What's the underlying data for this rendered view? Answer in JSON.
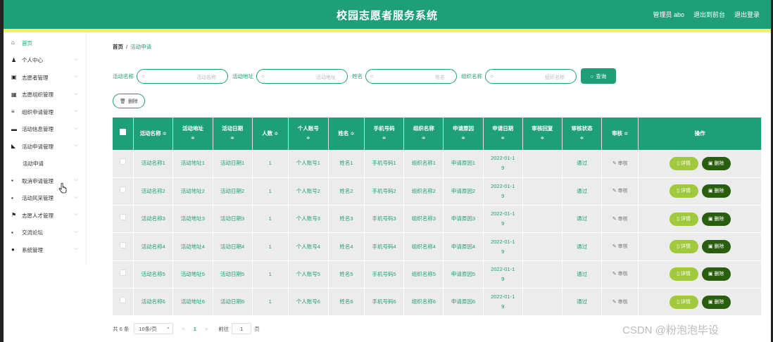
{
  "header": {
    "title": "校园志愿者服务系统",
    "links": [
      "管理员 abo",
      "退出到前台",
      "退出登录"
    ]
  },
  "sidebar": {
    "items": [
      {
        "label": "首页",
        "icon": "home-icon",
        "glyph": "⌂",
        "expandable": false
      },
      {
        "label": "个人中心",
        "icon": "user-icon",
        "glyph": "♟",
        "expandable": true
      },
      {
        "label": "志愿者管理",
        "icon": "badge-icon",
        "glyph": "▣",
        "expandable": true
      },
      {
        "label": "志愿组织管理",
        "icon": "grid-icon",
        "glyph": "▦",
        "expandable": true
      },
      {
        "label": "组织申请管理",
        "icon": "list-icon",
        "glyph": "≡",
        "expandable": true
      },
      {
        "label": "活动信息管理",
        "icon": "ticket-icon",
        "glyph": "▬",
        "expandable": true
      },
      {
        "label": "活动申请管理",
        "icon": "flag-icon",
        "glyph": "◣",
        "expandable": true,
        "sub": "活动申请"
      },
      {
        "label": "取消申请管理",
        "icon": "apps-icon",
        "glyph": "▪",
        "expandable": true
      },
      {
        "label": "活动风采管理",
        "icon": "apps-icon",
        "glyph": "▪",
        "expandable": true
      },
      {
        "label": "志愿人才管理",
        "icon": "flag-icon",
        "glyph": "⚑",
        "expandable": true
      },
      {
        "label": "交流论坛",
        "icon": "apps-icon",
        "glyph": "▪",
        "expandable": true
      },
      {
        "label": "系统管理",
        "icon": "location-icon",
        "glyph": "●",
        "expandable": true
      }
    ]
  },
  "breadcrumb": {
    "home": "首页",
    "sep": "/",
    "current": "活动申请"
  },
  "search": {
    "fields": [
      {
        "label": "活动名称",
        "placeholder": "活动名称"
      },
      {
        "label": "活动地址",
        "placeholder": "活动地址"
      },
      {
        "label": "姓名",
        "placeholder": "姓名"
      },
      {
        "label": "组织名称",
        "placeholder": "组织名称"
      }
    ],
    "query_label": "查询",
    "delete_label": "删除"
  },
  "table": {
    "columns": [
      "活动名称",
      "活动地址",
      "活动日期",
      "人数",
      "个人账号",
      "姓名",
      "手机号码",
      "组织名称",
      "申请原因",
      "申请日期",
      "审核回复",
      "审核状态",
      "审核",
      "操作"
    ],
    "rows": [
      [
        "活动名称1",
        "活动地址1",
        "活动日期1",
        "1",
        "个人账号1",
        "姓名1",
        "手机号码1",
        "组织名称1",
        "申请原因1",
        "2022-01-1",
        "9",
        "",
        "通过"
      ],
      [
        "活动名称2",
        "活动地址2",
        "活动日期2",
        "1",
        "个人账号2",
        "姓名2",
        "手机号码2",
        "组织名称2",
        "申请原因2",
        "2022-01-1",
        "9",
        "",
        "通过"
      ],
      [
        "活动名称3",
        "活动地址3",
        "活动日期3",
        "1",
        "个人账号3",
        "姓名3",
        "手机号码3",
        "组织名称3",
        "申请原因3",
        "2022-01-1",
        "9",
        "",
        "通过"
      ],
      [
        "活动名称4",
        "活动地址4",
        "活动日期4",
        "1",
        "个人账号4",
        "姓名4",
        "手机号码4",
        "组织名称4",
        "申请原因4",
        "2022-01-1",
        "9",
        "",
        "通过"
      ],
      [
        "活动名称5",
        "活动地址5",
        "活动日期5",
        "1",
        "个人账号5",
        "姓名5",
        "手机号码5",
        "组织名称5",
        "申请原因5",
        "2022-01-1",
        "9",
        "",
        "通过"
      ],
      [
        "活动名称6",
        "活动地址6",
        "活动日期6",
        "1",
        "个人账号6",
        "姓名6",
        "手机号码6",
        "组织名称6",
        "申请原因6",
        "2022-01-1",
        "9",
        "",
        "通过"
      ]
    ],
    "audit_label": "审核",
    "detail_label": "详情",
    "delete_label": "删除",
    "sort_glyph": "≑"
  },
  "pager": {
    "total": "共 6 条",
    "page_size": "10条/页",
    "prev": "<",
    "current": "1",
    "next": ">",
    "goto_label": "前往",
    "goto_value": "1",
    "goto_unit": "页"
  },
  "watermark": "CSDN @粉泡泡毕设",
  "colors": {
    "primary": "#1f9f77",
    "strip": "#f2f25a",
    "detail": "#a0c93e",
    "delete": "#2a5e0f"
  }
}
